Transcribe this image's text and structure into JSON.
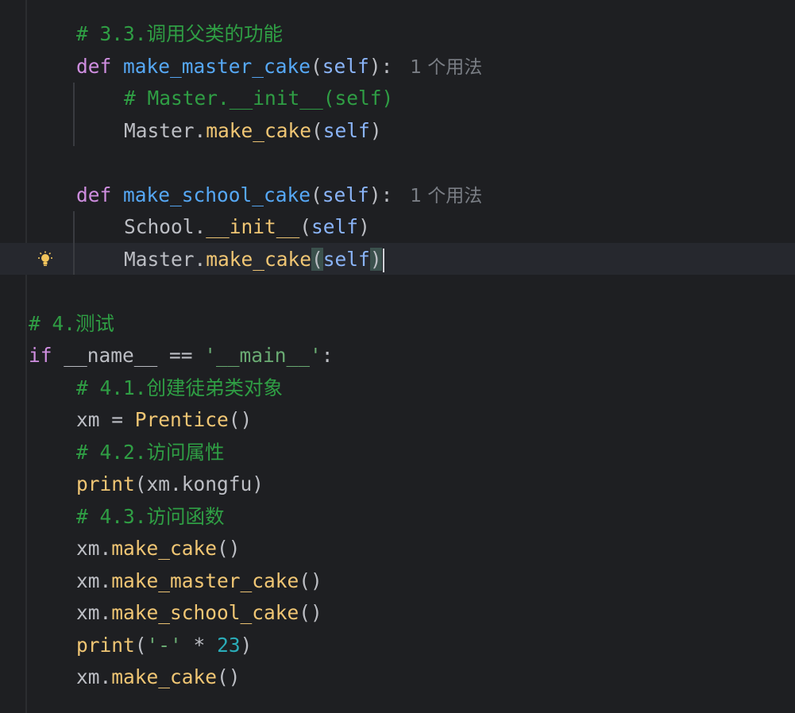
{
  "editor": {
    "lines": [
      {
        "id": "c33",
        "indent": 1,
        "tokens": [
          {
            "cls": "cm",
            "text": "# 3.3.调用父类的功能"
          }
        ]
      },
      {
        "id": "def_master",
        "indent": 1,
        "tokens": [
          {
            "cls": "kw",
            "text": "def "
          },
          {
            "cls": "fn",
            "text": "make_master_cake"
          },
          {
            "cls": "punc",
            "text": "("
          },
          {
            "cls": "selfp",
            "text": "self"
          },
          {
            "cls": "punc",
            "text": "):"
          }
        ],
        "hint": "1 个用法"
      },
      {
        "id": "cmt_init",
        "indent": 2,
        "tokens": [
          {
            "cls": "cm",
            "text": "# Master.__init__(self)"
          }
        ]
      },
      {
        "id": "master_make",
        "indent": 2,
        "tokens": [
          {
            "cls": "punc",
            "text": "Master."
          },
          {
            "cls": "call",
            "text": "make_cake"
          },
          {
            "cls": "punc",
            "text": "("
          },
          {
            "cls": "selfp",
            "text": "self"
          },
          {
            "cls": "punc",
            "text": ")"
          }
        ]
      },
      {
        "id": "blank1",
        "indent": 0,
        "tokens": []
      },
      {
        "id": "def_school",
        "indent": 1,
        "tokens": [
          {
            "cls": "kw",
            "text": "def "
          },
          {
            "cls": "fn",
            "text": "make_school_cake"
          },
          {
            "cls": "punc",
            "text": "("
          },
          {
            "cls": "selfp",
            "text": "self"
          },
          {
            "cls": "punc",
            "text": "):"
          }
        ],
        "hint": "1 个用法"
      },
      {
        "id": "school_init",
        "indent": 2,
        "tokens": [
          {
            "cls": "punc",
            "text": "School."
          },
          {
            "cls": "call",
            "text": "__init__"
          },
          {
            "cls": "punc",
            "text": "("
          },
          {
            "cls": "selfp",
            "text": "self"
          },
          {
            "cls": "punc",
            "text": ")"
          }
        ]
      },
      {
        "id": "master_make2",
        "indent": 2,
        "current": true,
        "tokens": [
          {
            "cls": "punc",
            "text": "Master."
          },
          {
            "cls": "call",
            "text": "make_cake"
          },
          {
            "cls": "punc bracket-match",
            "text": "("
          },
          {
            "cls": "selfp",
            "text": "self"
          },
          {
            "cls": "punc bracket-match",
            "text": ")"
          }
        ]
      },
      {
        "id": "blank2",
        "indent": 0,
        "tokens": []
      },
      {
        "id": "c4",
        "indent": 0,
        "tokens": [
          {
            "cls": "cm",
            "text": "# 4.测试"
          }
        ]
      },
      {
        "id": "ifmain",
        "indent": 0,
        "tokens": [
          {
            "cls": "kw",
            "text": "if "
          },
          {
            "cls": "punc",
            "text": "__name__ == "
          },
          {
            "cls": "str",
            "text": "'__main__'"
          },
          {
            "cls": "punc",
            "text": ":"
          }
        ]
      },
      {
        "id": "c41",
        "indent": 1,
        "tokens": [
          {
            "cls": "cm",
            "text": "# 4.1.创建徒弟类对象"
          }
        ]
      },
      {
        "id": "xm_new",
        "indent": 1,
        "tokens": [
          {
            "cls": "punc",
            "text": "xm = "
          },
          {
            "cls": "call",
            "text": "Prentice"
          },
          {
            "cls": "punc",
            "text": "()"
          }
        ]
      },
      {
        "id": "c42",
        "indent": 1,
        "tokens": [
          {
            "cls": "cm",
            "text": "# 4.2.访问属性"
          }
        ]
      },
      {
        "id": "print_kongfu",
        "indent": 1,
        "tokens": [
          {
            "cls": "call",
            "text": "print"
          },
          {
            "cls": "punc",
            "text": "(xm.kongfu)"
          }
        ]
      },
      {
        "id": "c43",
        "indent": 1,
        "tokens": [
          {
            "cls": "cm",
            "text": "# 4.3.访问函数"
          }
        ]
      },
      {
        "id": "xm_make",
        "indent": 1,
        "tokens": [
          {
            "cls": "punc",
            "text": "xm."
          },
          {
            "cls": "call",
            "text": "make_cake"
          },
          {
            "cls": "punc",
            "text": "()"
          }
        ]
      },
      {
        "id": "xm_master",
        "indent": 1,
        "tokens": [
          {
            "cls": "punc",
            "text": "xm."
          },
          {
            "cls": "call",
            "text": "make_master_cake"
          },
          {
            "cls": "punc",
            "text": "()"
          }
        ]
      },
      {
        "id": "xm_school",
        "indent": 1,
        "tokens": [
          {
            "cls": "punc",
            "text": "xm."
          },
          {
            "cls": "call",
            "text": "make_school_cake"
          },
          {
            "cls": "punc",
            "text": "()"
          }
        ]
      },
      {
        "id": "print_dash",
        "indent": 1,
        "tokens": [
          {
            "cls": "call",
            "text": "print"
          },
          {
            "cls": "punc",
            "text": "("
          },
          {
            "cls": "str",
            "text": "'-'"
          },
          {
            "cls": "punc",
            "text": " * "
          },
          {
            "cls": "num",
            "text": "23"
          },
          {
            "cls": "punc",
            "text": ")"
          }
        ]
      },
      {
        "id": "xm_make2",
        "indent": 1,
        "tokens": [
          {
            "cls": "punc",
            "text": "xm."
          },
          {
            "cls": "call",
            "text": "make_cake"
          },
          {
            "cls": "punc",
            "text": "()"
          }
        ]
      }
    ]
  },
  "intention_action": {
    "icon": "lightbulb-icon"
  },
  "colors": {
    "background": "#1e1f22",
    "keyword": "#cf8ee0",
    "function_def": "#56a8f5",
    "call": "#f0c674",
    "comment": "#2f9e44",
    "string": "#6aab73",
    "number": "#2aacb8",
    "bulb": "#f2c55c"
  }
}
